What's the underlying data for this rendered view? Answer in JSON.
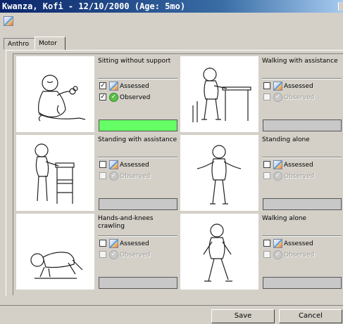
{
  "window": {
    "title": "Kwanza, Kofi - 12/10/2000 (Age: 5mo)"
  },
  "tabs": [
    {
      "label": "Anthro"
    },
    {
      "label": "Motor"
    }
  ],
  "milestones": [
    {
      "name": "Sitting without support",
      "assessed": true,
      "observed": true,
      "observed_enabled": true,
      "status_color": "#66ff66"
    },
    {
      "name": "Walking with assistance",
      "assessed": false,
      "observed": false,
      "observed_enabled": false,
      "status_color": "#c8c8c8"
    },
    {
      "name": "Standing with assistance",
      "assessed": false,
      "observed": false,
      "observed_enabled": false,
      "status_color": "#c8c8c8"
    },
    {
      "name": "Standing alone",
      "assessed": false,
      "observed": false,
      "observed_enabled": false,
      "status_color": "#c8c8c8"
    },
    {
      "name": "Hands-and-knees crawling",
      "assessed": false,
      "observed": false,
      "observed_enabled": false,
      "status_color": "#c8c8c8"
    },
    {
      "name": "Walking alone",
      "assessed": false,
      "observed": false,
      "observed_enabled": false,
      "status_color": "#c8c8c8"
    }
  ],
  "labels": {
    "assessed": "Assessed",
    "observed": "Observed"
  },
  "buttons": {
    "save": "Save",
    "cancel": "Cancel"
  }
}
